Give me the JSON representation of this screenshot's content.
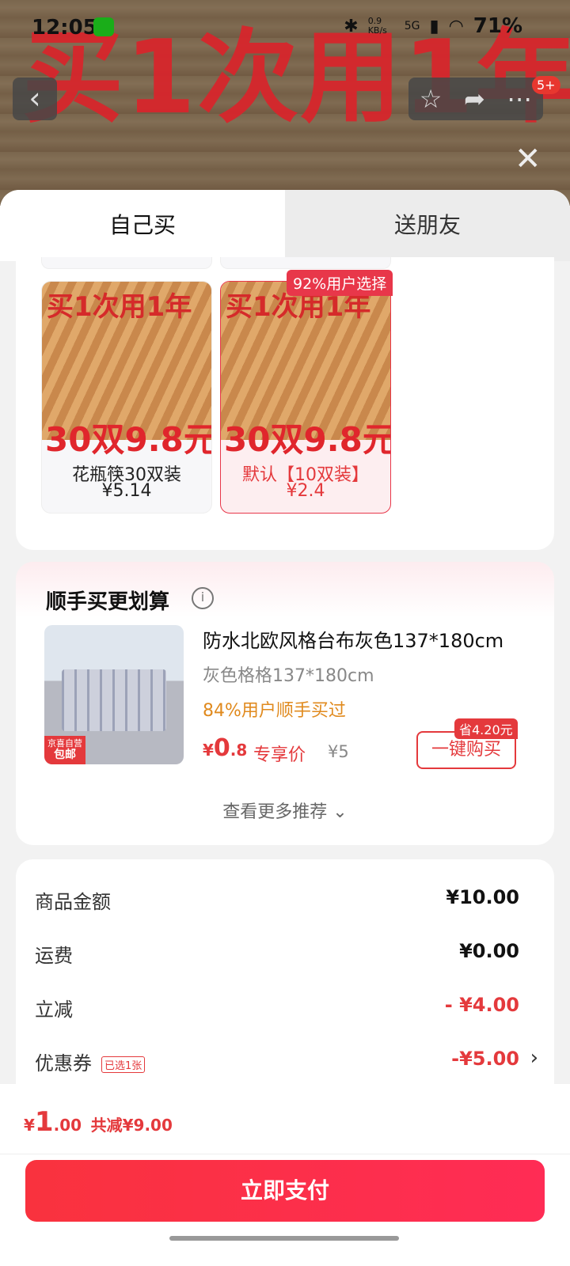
{
  "status_bar": {
    "time": "12:05",
    "net_speed": "0.9 KB/s",
    "network": "5G",
    "battery": "71%"
  },
  "header": {
    "banner_text": "买1次用1年",
    "cart_badge": "5+"
  },
  "tabs": [
    {
      "label": "自己买",
      "active": true
    },
    {
      "label": "送朋友",
      "active": false
    }
  ],
  "sku_options": [
    {
      "image_title": "买1次用1年",
      "image_price": "30双9.8元",
      "name": "花瓶筷30双装",
      "price": "¥5.14",
      "selected": false,
      "tag": ""
    },
    {
      "image_title": "买1次用1年",
      "image_price": "30双9.8元",
      "name": "默认【10双装】",
      "price": "¥2.4",
      "selected": true,
      "tag": "92%用户选择"
    }
  ],
  "recommend": {
    "section_title": "顺手买更划算",
    "product": {
      "name": "防水北欧风格台布灰色137*180cm",
      "spec": "灰色格格137*180cm",
      "bought": "84%用户顺手买过",
      "price_symbol": "¥",
      "price_int": "0",
      "price_dec": ".8",
      "exclusive_label": "专享价",
      "original_price": "¥5",
      "save_tag": "省4.20元",
      "buy_label": "一键购买",
      "badge_line1": "京喜自营",
      "badge_line2": "包邮"
    },
    "more_label": "查看更多推荐"
  },
  "price_summary": [
    {
      "label": "商品金额",
      "value": "¥10.00",
      "red": false
    },
    {
      "label": "运费",
      "value": "¥0.00",
      "red": false
    },
    {
      "label": "立减",
      "value": "- ¥4.00",
      "red": true
    },
    {
      "label": "优惠券",
      "value": "-¥5.00",
      "red": true,
      "tag": "已选1张"
    }
  ],
  "footer": {
    "total_symbol": "¥",
    "total_int": "1",
    "total_dec": ".00",
    "total_saved": "共减¥9.00",
    "pay_label": "立即支付"
  },
  "colors": {
    "accent": "#e4393c",
    "pay_button": "#f9323e",
    "orange": "#e08a1e"
  },
  "icons": [
    "back-icon",
    "star-icon",
    "share-icon",
    "more-icon",
    "close-icon",
    "info-icon",
    "chevron-down-icon",
    "chevron-right-icon"
  ]
}
